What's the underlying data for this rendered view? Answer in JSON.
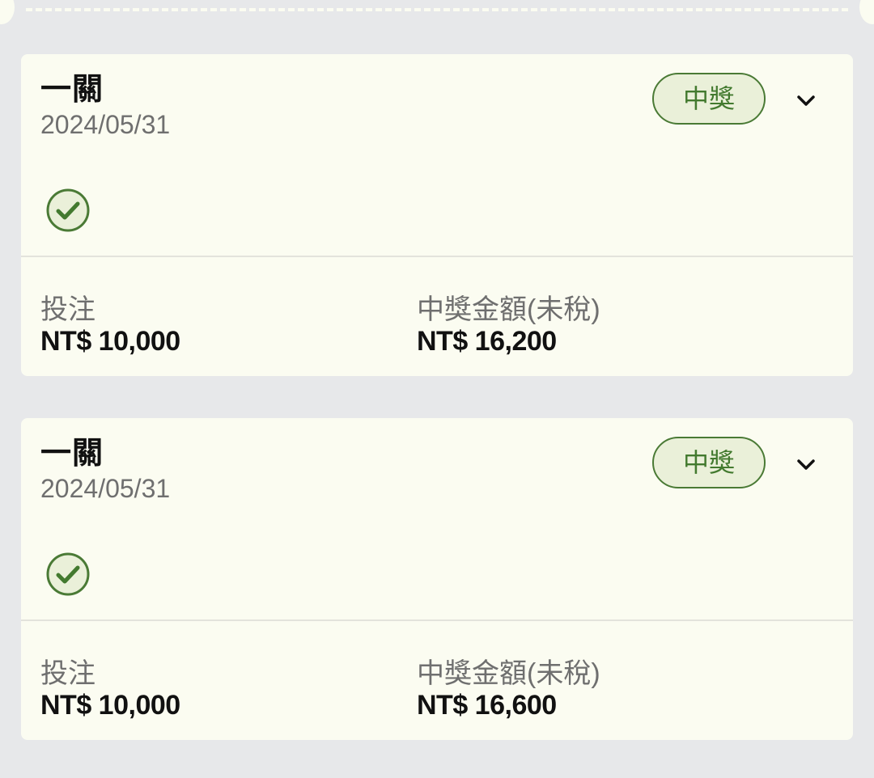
{
  "colors": {
    "background": "#e7e8ea",
    "card": "#fbfcf1",
    "accent_green": "#437a2f",
    "badge_fill": "#eaf0d9"
  },
  "icons": {
    "expand": "chevron-down-icon",
    "result": "check-circle-icon"
  },
  "bets": [
    {
      "title": "一關",
      "date": "2024/05/31",
      "status": "中獎",
      "stake_label": "投注",
      "stake_value": "NT$ 10,000",
      "payout_label": "中獎金額(未稅)",
      "payout_value": "NT$ 16,200"
    },
    {
      "title": "一關",
      "date": "2024/05/31",
      "status": "中獎",
      "stake_label": "投注",
      "stake_value": "NT$ 10,000",
      "payout_label": "中獎金額(未稅)",
      "payout_value": "NT$ 16,600"
    }
  ]
}
